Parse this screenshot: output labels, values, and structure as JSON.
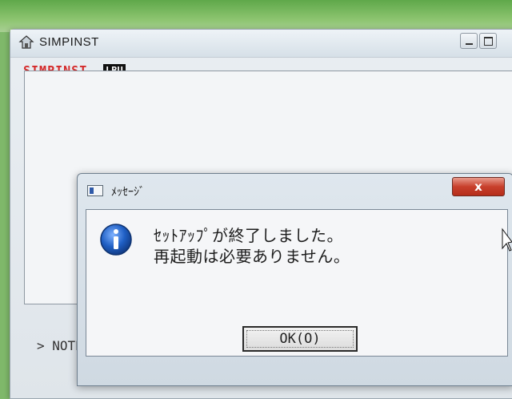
{
  "main_window": {
    "title": "SIMPINST",
    "brand_name": "SIMPINST",
    "brand_badge": "LBU",
    "status_line": "> NOTEPAD README.TXT を実行中です。"
  },
  "dialog": {
    "title": "ﾒｯｾｰｼﾞ",
    "close_label": "x",
    "message_line1": "ｾｯﾄｱｯﾌﾟが終了しました。",
    "message_line2": "再起動は必要ありません。",
    "ok_label": "OK(O)",
    "icon": "information-icon"
  },
  "colors": {
    "brand_red": "#d42a2a",
    "close_red": "#c8402c",
    "info_blue": "#1f5fc4"
  }
}
